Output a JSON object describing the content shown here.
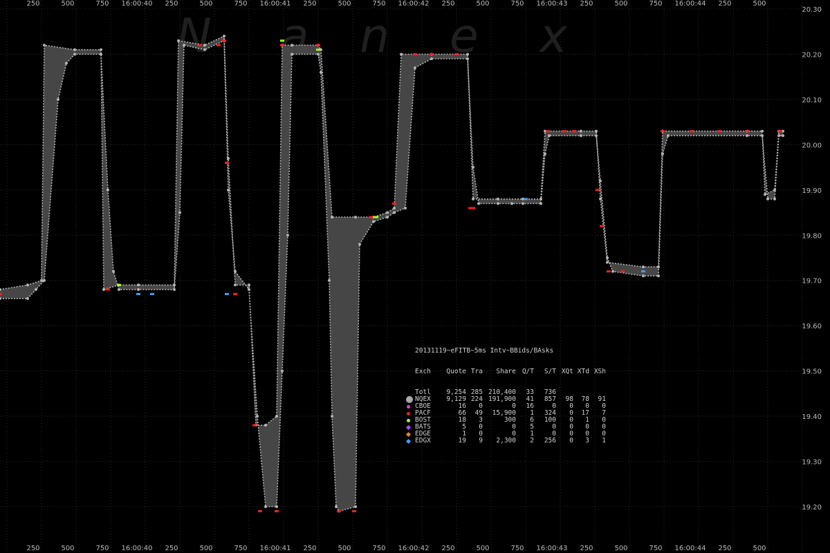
{
  "watermark": "Nanex",
  "stats_table": {
    "title": "20131119~eFITB~5ms Intv~BBids/BAsks",
    "headers": [
      "Exch",
      "Quote",
      "Tra",
      "Share",
      "Q/T",
      "S/T",
      "XQt",
      "XTd",
      "XSh"
    ],
    "rows": [
      {
        "marker": "none",
        "color": "",
        "cells": [
          "Totl",
          "9,254",
          "285",
          "210,400",
          "33",
          "736",
          "",
          "",
          ""
        ]
      },
      {
        "marker": "bigdot",
        "color": "#aaaaaa",
        "cells": [
          "NQEX",
          "9,129",
          "224",
          "191,900",
          "41",
          "857",
          "98",
          "78",
          "91"
        ]
      },
      {
        "marker": "dot",
        "color": "#e040e0",
        "cells": [
          "CBOE",
          "16",
          "0",
          "0",
          "16",
          "0",
          "0",
          "0",
          "0"
        ]
      },
      {
        "marker": "dot",
        "color": "#ff2020",
        "cells": [
          "PACF",
          "66",
          "49",
          "15,900",
          "1",
          "324",
          "0",
          "17",
          "7"
        ]
      },
      {
        "marker": "dot",
        "color": "#a8ff20",
        "cells": [
          "BOST",
          "18",
          "3",
          "300",
          "6",
          "100",
          "0",
          "1",
          "0"
        ]
      },
      {
        "marker": "diamond",
        "color": "#b050ff",
        "cells": [
          "BATS",
          "5",
          "0",
          "0",
          "5",
          "0",
          "0",
          "0",
          "0"
        ]
      },
      {
        "marker": "diamond",
        "color": "#e09020",
        "cells": [
          "EDGE",
          "1",
          "0",
          "0",
          "1",
          "0",
          "0",
          "0",
          "0"
        ]
      },
      {
        "marker": "diamond",
        "color": "#40a0ff",
        "cells": [
          "EDGX",
          "19",
          "9",
          "2,300",
          "2",
          "256",
          "0",
          "3",
          "1"
        ]
      }
    ]
  },
  "chart_data": {
    "type": "line",
    "title": "",
    "xlabel": "",
    "ylabel": "",
    "x_tick_labels": [
      "250",
      "500",
      "750",
      "16:00:40",
      "250",
      "500",
      "750",
      "16:00:41",
      "250",
      "500",
      "750",
      "16:00:42",
      "250",
      "500",
      "750",
      "16:00:43",
      "250",
      "500",
      "750",
      "16:00:44",
      "250",
      "500"
    ],
    "y_tick_labels": [
      "20.30",
      "20.20",
      "20.10",
      "20.00",
      "19.90",
      "19.80",
      "19.70",
      "19.60",
      "19.50",
      "19.40",
      "19.30",
      "19.20"
    ],
    "ylim": [
      19.15,
      20.3
    ],
    "xlim_ms": [
      0,
      5800
    ],
    "grid": true,
    "colors": {
      "bid_fill": "#4a4a4a",
      "quote_dots": "#b4b4b4",
      "pacf_trades": "#ff2020",
      "bost": "#a8ff20",
      "edgx": "#40a0ff"
    },
    "series": [
      {
        "name": "BBids",
        "points": [
          [
            0,
            19.66
          ],
          [
            200,
            19.66
          ],
          [
            260,
            19.68
          ],
          [
            320,
            19.7
          ],
          [
            420,
            20.1
          ],
          [
            480,
            20.18
          ],
          [
            540,
            20.2
          ],
          [
            730,
            20.2
          ],
          [
            780,
            19.9
          ],
          [
            820,
            19.72
          ],
          [
            860,
            19.68
          ],
          [
            1000,
            19.68
          ],
          [
            1260,
            19.68
          ],
          [
            1300,
            19.85
          ],
          [
            1330,
            20.22
          ],
          [
            1480,
            20.21
          ],
          [
            1620,
            20.23
          ],
          [
            1650,
            19.9
          ],
          [
            1700,
            19.72
          ],
          [
            1800,
            19.68
          ],
          [
            1860,
            19.4
          ],
          [
            1920,
            19.2
          ],
          [
            2000,
            19.2
          ],
          [
            2040,
            19.5
          ],
          [
            2080,
            19.8
          ],
          [
            2110,
            20.2
          ],
          [
            2300,
            20.2
          ],
          [
            2320,
            20.16
          ],
          [
            2380,
            19.7
          ],
          [
            2400,
            19.4
          ],
          [
            2430,
            19.2
          ],
          [
            2450,
            19.19
          ],
          [
            2570,
            19.2
          ],
          [
            2600,
            19.78
          ],
          [
            2700,
            19.83
          ],
          [
            2800,
            19.84
          ],
          [
            2850,
            19.85
          ],
          [
            2930,
            19.86
          ],
          [
            3000,
            20.17
          ],
          [
            3120,
            20.19
          ],
          [
            3380,
            20.19
          ],
          [
            3420,
            19.95
          ],
          [
            3460,
            19.87
          ],
          [
            3600,
            19.87
          ],
          [
            3700,
            19.87
          ],
          [
            3780,
            19.87
          ],
          [
            3910,
            19.87
          ],
          [
            3940,
            19.98
          ],
          [
            3970,
            20.02
          ],
          [
            4200,
            20.02
          ],
          [
            4310,
            20.02
          ],
          [
            4340,
            19.92
          ],
          [
            4390,
            19.75
          ],
          [
            4430,
            19.72
          ],
          [
            4650,
            19.71
          ],
          [
            4760,
            19.71
          ],
          [
            4790,
            19.98
          ],
          [
            4830,
            20.02
          ],
          [
            5400,
            20.02
          ],
          [
            5510,
            20.02
          ],
          [
            5550,
            19.88
          ],
          [
            5600,
            19.88
          ],
          [
            5630,
            20.02
          ],
          [
            5660,
            20.02
          ]
        ]
      },
      {
        "name": "BAsks",
        "points": [
          [
            0,
            19.68
          ],
          [
            200,
            19.69
          ],
          [
            300,
            19.7
          ],
          [
            320,
            20.22
          ],
          [
            540,
            20.21
          ],
          [
            730,
            20.21
          ],
          [
            750,
            19.68
          ],
          [
            860,
            19.69
          ],
          [
            1000,
            19.69
          ],
          [
            1260,
            19.69
          ],
          [
            1290,
            20.23
          ],
          [
            1480,
            20.22
          ],
          [
            1620,
            20.24
          ],
          [
            1650,
            19.97
          ],
          [
            1700,
            19.69
          ],
          [
            1800,
            19.69
          ],
          [
            1850,
            19.38
          ],
          [
            1920,
            19.38
          ],
          [
            2000,
            19.4
          ],
          [
            2040,
            20.22
          ],
          [
            2110,
            20.22
          ],
          [
            2300,
            20.22
          ],
          [
            2320,
            20.21
          ],
          [
            2400,
            19.84
          ],
          [
            2570,
            19.84
          ],
          [
            2700,
            19.84
          ],
          [
            2800,
            19.85
          ],
          [
            2850,
            19.86
          ],
          [
            2900,
            20.2
          ],
          [
            3120,
            20.2
          ],
          [
            3380,
            20.2
          ],
          [
            3420,
            19.88
          ],
          [
            3600,
            19.88
          ],
          [
            3780,
            19.88
          ],
          [
            3910,
            19.88
          ],
          [
            3940,
            20.03
          ],
          [
            4200,
            20.03
          ],
          [
            4310,
            20.03
          ],
          [
            4340,
            19.88
          ],
          [
            4390,
            19.74
          ],
          [
            4650,
            19.73
          ],
          [
            4760,
            19.73
          ],
          [
            4790,
            20.03
          ],
          [
            5400,
            20.03
          ],
          [
            5510,
            20.03
          ],
          [
            5530,
            19.89
          ],
          [
            5600,
            19.9
          ],
          [
            5630,
            20.03
          ],
          [
            5660,
            20.03
          ]
        ]
      }
    ],
    "trades": [
      {
        "exch": "PACF",
        "color": "#ff2020",
        "points": [
          [
            0,
            19.67
          ],
          [
            780,
            19.68
          ],
          [
            1440,
            20.22
          ],
          [
            1580,
            20.22
          ],
          [
            1620,
            20.23
          ],
          [
            1640,
            19.96
          ],
          [
            1700,
            19.67
          ],
          [
            1840,
            19.38
          ],
          [
            1880,
            19.19
          ],
          [
            2000,
            19.19
          ],
          [
            2040,
            20.22
          ],
          [
            2300,
            20.22
          ],
          [
            2450,
            19.19
          ],
          [
            2560,
            19.19
          ],
          [
            2680,
            19.84
          ],
          [
            2850,
            19.87
          ],
          [
            3000,
            20.2
          ],
          [
            3120,
            20.2
          ],
          [
            3300,
            20.2
          ],
          [
            3400,
            19.86
          ],
          [
            3420,
            19.86
          ],
          [
            3960,
            20.03
          ],
          [
            4080,
            20.03
          ],
          [
            4150,
            20.03
          ],
          [
            4320,
            19.9
          ],
          [
            4350,
            19.82
          ],
          [
            4400,
            19.72
          ],
          [
            4500,
            19.72
          ],
          [
            4790,
            20.03
          ],
          [
            5000,
            20.03
          ],
          [
            5200,
            20.03
          ],
          [
            5400,
            20.03
          ],
          [
            5640,
            20.03
          ]
        ]
      },
      {
        "exch": "BOST",
        "color": "#a8ff20",
        "points": [
          [
            860,
            19.69
          ],
          [
            2040,
            20.23
          ],
          [
            2300,
            20.21
          ],
          [
            2720,
            19.84
          ]
        ]
      },
      {
        "exch": "EDGX",
        "color": "#40a0ff",
        "points": [
          [
            1000,
            19.67
          ],
          [
            1100,
            19.67
          ],
          [
            1640,
            19.67
          ],
          [
            3800,
            19.88
          ],
          [
            4650,
            19.72
          ]
        ]
      }
    ]
  }
}
